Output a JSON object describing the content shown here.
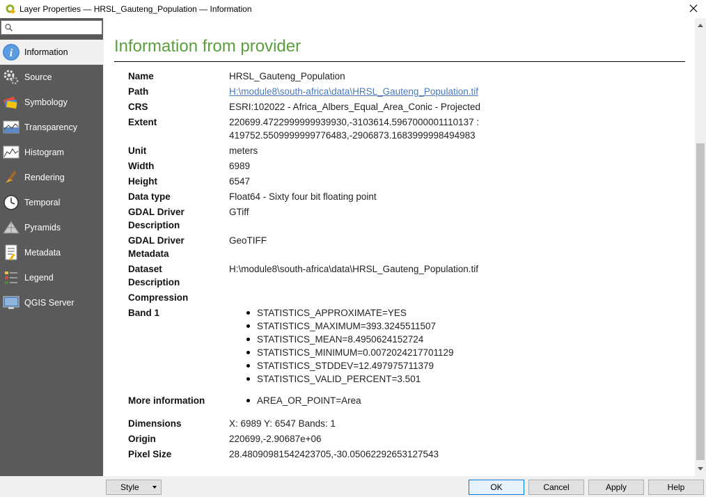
{
  "window": {
    "title": "Layer Properties — HRSL_Gauteng_Population — Information"
  },
  "search": {
    "value": "",
    "placeholder": ""
  },
  "sidebar": {
    "items": [
      {
        "label": "Information",
        "icon": "information-icon"
      },
      {
        "label": "Source",
        "icon": "source-icon"
      },
      {
        "label": "Symbology",
        "icon": "symbology-icon"
      },
      {
        "label": "Transparency",
        "icon": "transparency-icon"
      },
      {
        "label": "Histogram",
        "icon": "histogram-icon"
      },
      {
        "label": "Rendering",
        "icon": "rendering-icon"
      },
      {
        "label": "Temporal",
        "icon": "temporal-icon"
      },
      {
        "label": "Pyramids",
        "icon": "pyramids-icon"
      },
      {
        "label": "Metadata",
        "icon": "metadata-icon"
      },
      {
        "label": "Legend",
        "icon": "legend-icon"
      },
      {
        "label": "QGIS Server",
        "icon": "qgis-server-icon"
      }
    ]
  },
  "main": {
    "heading": "Information from provider",
    "rows": {
      "name": {
        "key": "Name",
        "value": "HRSL_Gauteng_Population"
      },
      "path": {
        "key": "Path",
        "value": "H:\\module8\\south-africa\\data\\HRSL_Gauteng_Population.tif"
      },
      "crs": {
        "key": "CRS",
        "value": "ESRI:102022 - Africa_Albers_Equal_Area_Conic - Projected"
      },
      "extent": {
        "key": "Extent",
        "line1": "220699.4722999999939930,-3103614.5967000001110137 :",
        "line2": "419752.5509999999776483,-2906873.1683999998494983"
      },
      "unit": {
        "key": "Unit",
        "value": "meters"
      },
      "width": {
        "key": "Width",
        "value": "6989"
      },
      "height": {
        "key": "Height",
        "value": "6547"
      },
      "data_type": {
        "key": "Data type",
        "value": "Float64 - Sixty four bit floating point"
      },
      "gdal_driver_description": {
        "key_line1": "GDAL Driver",
        "key_line2": "Description",
        "value": "GTiff"
      },
      "gdal_driver_metadata": {
        "key_line1": "GDAL Driver",
        "key_line2": "Metadata",
        "value": "GeoTIFF"
      },
      "dataset_description": {
        "key_line1": "Dataset",
        "key_line2": "Description",
        "value": "H:\\module8\\south-africa\\data\\HRSL_Gauteng_Population.tif"
      },
      "compression": {
        "key": "Compression",
        "value": ""
      },
      "band1": {
        "key": "Band 1",
        "items": [
          "STATISTICS_APPROXIMATE=YES",
          "STATISTICS_MAXIMUM=393.3245511507",
          "STATISTICS_MEAN=8.4950624152724",
          "STATISTICS_MINIMUM=0.0072024217701129",
          "STATISTICS_STDDEV=12.497975711379",
          "STATISTICS_VALID_PERCENT=3.501"
        ]
      },
      "more_information": {
        "key": "More information",
        "items": [
          "AREA_OR_POINT=Area"
        ]
      },
      "dimensions": {
        "key": "Dimensions",
        "value": "X: 6989 Y: 6547 Bands: 1"
      },
      "origin": {
        "key": "Origin",
        "value": "220699,-2.90687e+06"
      },
      "pixel_size": {
        "key": "Pixel Size",
        "value": "28.48090981542423705,-30.05062292653127543"
      }
    }
  },
  "buttons": {
    "style": "Style",
    "ok": "OK",
    "cancel": "Cancel",
    "apply": "Apply",
    "help": "Help"
  },
  "colors": {
    "heading": "#5a9f3c",
    "sidebar_bg": "#5a5a5a",
    "link": "#4a7ab5"
  }
}
